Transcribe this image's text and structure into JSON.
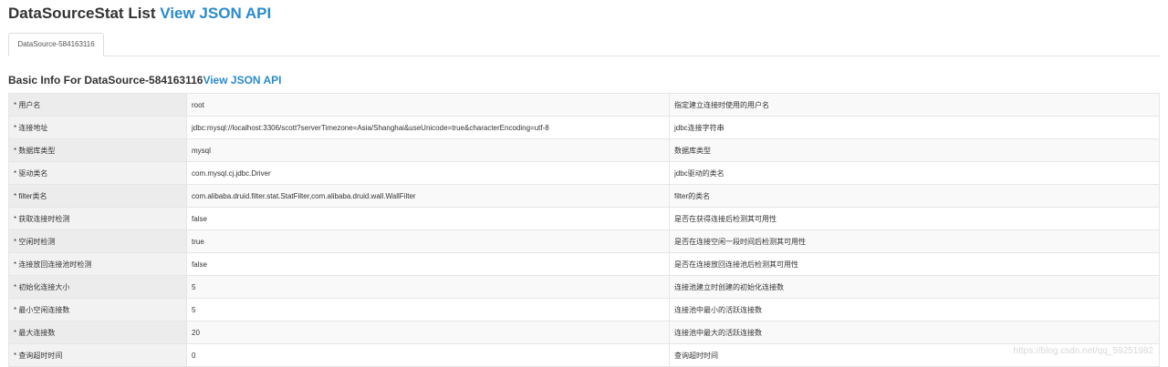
{
  "header": {
    "title": "DataSourceStat List",
    "json_link": "View JSON API"
  },
  "tabs": [
    {
      "label": "DataSource-584163116",
      "active": true
    }
  ],
  "section": {
    "title": "Basic Info For DataSource-584163116",
    "json_link": "View JSON API"
  },
  "rows": [
    {
      "label": "* 用户名",
      "value": "root",
      "desc": "指定建立连接时使用的用户名"
    },
    {
      "label": "* 连接地址",
      "value": "jdbc:mysql://localhost:3306/scott?serverTimezone=Asia/Shanghai&useUnicode=true&characterEncoding=utf-8",
      "desc": "jdbc连接字符串"
    },
    {
      "label": "* 数据库类型",
      "value": "mysql",
      "desc": "数据库类型"
    },
    {
      "label": "* 驱动类名",
      "value": "com.mysql.cj.jdbc.Driver",
      "desc": "jdbc驱动的类名"
    },
    {
      "label": "* filter类名",
      "value": "com.alibaba.druid.filter.stat.StatFilter,com.alibaba.druid.wall.WallFilter",
      "desc": "filter的类名"
    },
    {
      "label": "* 获取连接时检测",
      "value": "false",
      "desc": "是否在获得连接后检测其可用性"
    },
    {
      "label": "* 空闲时检测",
      "value": "true",
      "desc": "是否在连接空闲一段时间后检测其可用性"
    },
    {
      "label": "* 连接放回连接池时检测",
      "value": "false",
      "desc": "是否在连接放回连接池后检测其可用性"
    },
    {
      "label": "* 初始化连接大小",
      "value": "5",
      "desc": "连接池建立时创建的初始化连接数"
    },
    {
      "label": "* 最小空闲连接数",
      "value": "5",
      "desc": "连接池中最小的活跃连接数"
    },
    {
      "label": "* 最大连接数",
      "value": "20",
      "desc": "连接池中最大的活跃连接数"
    },
    {
      "label": "* 查询超时时间",
      "value": "0",
      "desc": "查询超时时间"
    }
  ],
  "watermark": "https://blog.csdn.net/qq_59251982"
}
